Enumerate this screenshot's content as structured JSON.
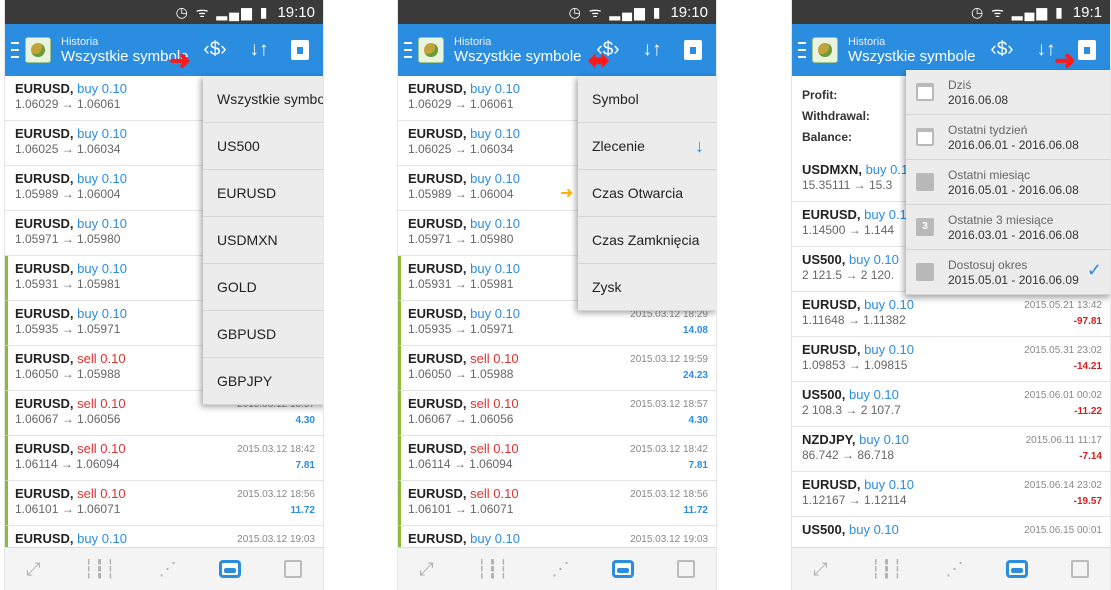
{
  "status": {
    "time": "19:10",
    "time_cut": "19:1",
    "icons": "◷ ᯤ ▂▄▆ ▮"
  },
  "header": {
    "title_small": "Historia",
    "title": "Wszystkie symbole"
  },
  "icons": {
    "symbols": "symbols-icon",
    "sort": "sort-icon",
    "calendar": "calendar-icon"
  },
  "colors": {
    "header": "#2b8de0",
    "buy": "#2b8de0",
    "sell": "#e03030",
    "marker": "#8cba3c",
    "annotation_arrow": "#ff1a1a"
  },
  "trades": [
    {
      "symbol": "EURUSD,",
      "side": "buy 0.10",
      "prices": "1.06029 → 1.06061",
      "time": "",
      "profit": ""
    },
    {
      "symbol": "EURUSD,",
      "side": "buy 0.10",
      "prices": "1.06025 → 1.06034",
      "time": "",
      "profit": ""
    },
    {
      "symbol": "EURUSD,",
      "side": "buy 0.10",
      "prices": "1.05989 → 1.06004",
      "time": "",
      "profit": ""
    },
    {
      "symbol": "EURUSD,",
      "side": "buy 0.10",
      "prices": "1.05971 → 1.05980",
      "time": "",
      "profit": ""
    },
    {
      "symbol": "EURUSD,",
      "side": "buy 0.10",
      "prices": "1.05931 → 1.05981",
      "time": "",
      "profit": ""
    },
    {
      "symbol": "EURUSD,",
      "side": "buy 0.10",
      "prices": "1.05935 → 1.05971",
      "time": "2015.03.12 18:29",
      "profit": "14.08"
    },
    {
      "symbol": "EURUSD,",
      "side": "sell 0.10",
      "prices": "1.06050 → 1.05988",
      "time": "2015.03.12 19:59",
      "profit": "24.23"
    },
    {
      "symbol": "EURUSD,",
      "side": "sell 0.10",
      "prices": "1.06067 → 1.06056",
      "time": "2015.03.12 18:57",
      "profit": "4.30"
    },
    {
      "symbol": "EURUSD,",
      "side": "sell 0.10",
      "prices": "1.06114 → 1.06094",
      "time": "2015.03.12 18:42",
      "profit": "7.81"
    },
    {
      "symbol": "EURUSD,",
      "side": "sell 0.10",
      "prices": "1.06101 → 1.06071",
      "time": "2015.03.12 18:56",
      "profit": "11.72"
    },
    {
      "symbol": "EURUSD,",
      "side": "buy 0.10",
      "prices": "",
      "time": "2015.03.12 19:03",
      "profit": ""
    }
  ],
  "symbol_menu": [
    "Wszystkie symbole",
    "US500",
    "EURUSD",
    "USDMXN",
    "GOLD",
    "GBPUSD",
    "GBPJPY"
  ],
  "sort_menu": [
    "Symbol",
    "Zlecenie",
    "Czas Otwarcia",
    "Czas Zamknięcia",
    "Zysk"
  ],
  "sort_arrow": "↓",
  "summary": {
    "profit": "Profit:",
    "withdrawal": "Withdrawal:",
    "balance": "Balance:"
  },
  "phone3_rows": [
    {
      "symbol": "USDMXN,",
      "side": "buy 0.1",
      "prices": "15.35111 → 15.3",
      "time": "",
      "profit": ""
    },
    {
      "symbol": "EURUSD,",
      "side": "buy 0.1",
      "prices": "1.14500 → 1.144",
      "time": "",
      "profit": ""
    },
    {
      "symbol": "US500,",
      "side": "buy 0.10",
      "prices": "2 121.5 → 2 120.",
      "time": "",
      "profit": ""
    },
    {
      "symbol": "EURUSD,",
      "side": "buy 0.10",
      "prices": "1.11648 → 1.11382",
      "time": "2015.05.21 13:42",
      "profit": "-97.81"
    },
    {
      "symbol": "EURUSD,",
      "side": "buy 0.10",
      "prices": "1.09853 → 1.09815",
      "time": "2015.05.31 23:02",
      "profit": "-14.21"
    },
    {
      "symbol": "US500,",
      "side": "buy 0.10",
      "prices": "2 108.3 → 2 107.7",
      "time": "2015.06.01 00:02",
      "profit": "-11.22"
    },
    {
      "symbol": "NZDJPY,",
      "side": "buy 0.10",
      "prices": "86.742 → 86.718",
      "time": "2015.06.11 11:17",
      "profit": "-7.14"
    },
    {
      "symbol": "EURUSD,",
      "side": "buy 0.10",
      "prices": "1.12167 → 1.12114",
      "time": "2015.06.14 23:02",
      "profit": "-19.57"
    },
    {
      "symbol": "US500,",
      "side": "buy 0.10",
      "prices": "",
      "time": "2015.06.15 00:01",
      "profit": ""
    }
  ],
  "period_menu": [
    {
      "label": "Dziś",
      "dates": "2016.06.08",
      "icon": "calendar-icon"
    },
    {
      "label": "Ostatni tydzień",
      "dates": "2016.06.01 - 2016.06.08",
      "icon": "calendar-icon"
    },
    {
      "label": "Ostatni miesiąc",
      "dates": "2016.05.01 - 2016.06.08",
      "icon": "calendar-icon"
    },
    {
      "label": "Ostatnie 3 miesiące",
      "dates": "2016.03.01 - 2016.06.08",
      "icon": "calendar-icon",
      "icon_text": "3"
    },
    {
      "label": "Dostosuj okres",
      "dates": "2015.05.01 - 2016.06.09",
      "icon": "calendar-icon"
    }
  ],
  "period_check": "✓",
  "nav": [
    "trade-icon",
    "chart-icon",
    "scalp-icon",
    "history-icon",
    "news-icon"
  ]
}
